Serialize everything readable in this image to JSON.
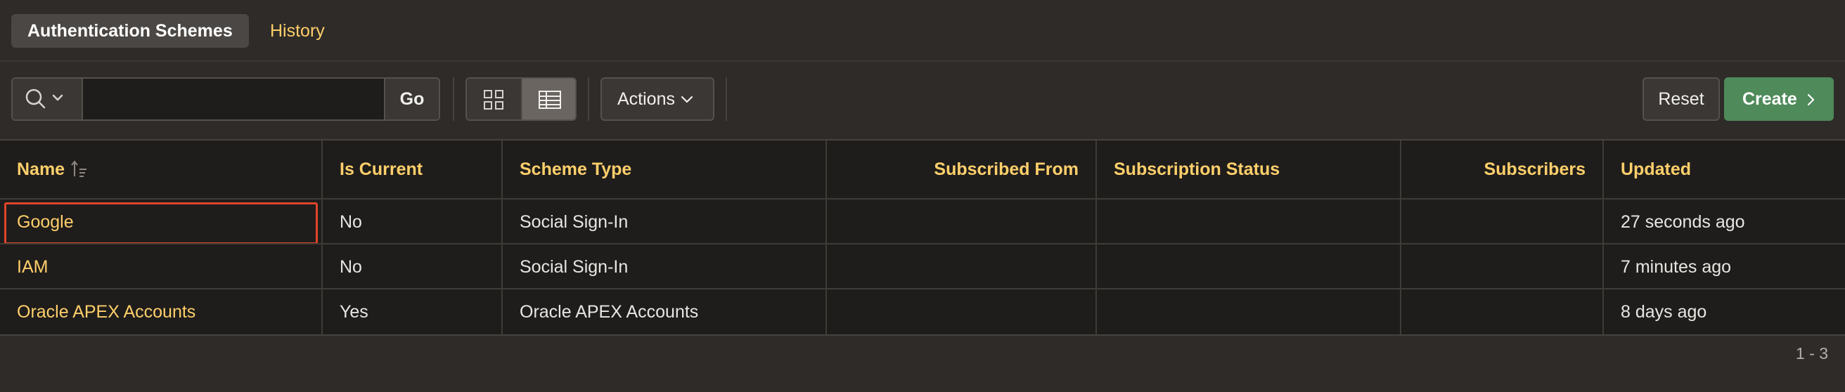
{
  "tabs": {
    "active_label": "Authentication Schemes",
    "inactive_label": "History"
  },
  "toolbar": {
    "search_value": "",
    "go_label": "Go",
    "actions_label": "Actions",
    "reset_label": "Reset",
    "create_label": "Create"
  },
  "icons": {
    "search": "search-icon",
    "chevron_down": "chevron-down-icon",
    "icon_view": "grid-view-icon",
    "report_view": "report-view-icon",
    "chevron_right": "chevron-right-icon",
    "sort_asc": "sort-ascending-icon"
  },
  "colors": {
    "accent_link": "#ffcf6b",
    "create_button": "#4e8a5a",
    "focus_outline": "#e0442b"
  },
  "table": {
    "columns": [
      "Name",
      "Is Current",
      "Scheme Type",
      "Subscribed From",
      "Subscription Status",
      "Subscribers",
      "Updated"
    ],
    "rows": [
      [
        "Google",
        "No",
        "Social Sign-In",
        "",
        "",
        "",
        "27 seconds ago"
      ],
      [
        "IAM",
        "No",
        "Social Sign-In",
        "",
        "",
        "",
        "7 minutes ago"
      ],
      [
        "Oracle APEX Accounts",
        "Yes",
        "Oracle APEX Accounts",
        "",
        "",
        "",
        "8 days ago"
      ]
    ]
  },
  "pagination": "1 - 3"
}
